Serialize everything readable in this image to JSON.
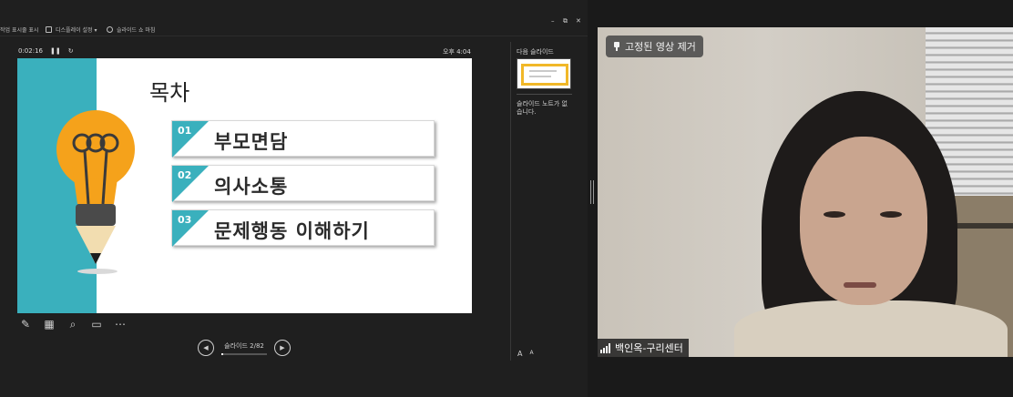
{
  "toolbar": {
    "show_taskbar": "작업 표시줄 표시",
    "display_settings": "디스플레이 설정 ▾",
    "end_slideshow": "슬라이드 쇼 마침"
  },
  "window_controls": {
    "minimize": "–",
    "restore": "⧉",
    "close": "✕"
  },
  "presenter": {
    "elapsed": "0:02:16",
    "pause": "❚❚",
    "reset": "↻",
    "clock": "오후 4:04",
    "next_slide_label": "다음 슬라이드",
    "notes_text": "슬라이드 노트가 없습니다.",
    "font_increase": "A",
    "font_decrease": "A"
  },
  "slide": {
    "title": "목차",
    "items": [
      {
        "num": "01",
        "label": "부모면담"
      },
      {
        "num": "02",
        "label": "의사소통"
      },
      {
        "num": "03",
        "label": "문제행동 이해하기"
      }
    ]
  },
  "navigation": {
    "prev": "◀",
    "next": "▶",
    "counter": "슬라이드 2/82",
    "progress": 0.0244
  },
  "tools": {
    "pen": "✎",
    "grid": "▦",
    "zoom": "⌕",
    "screen": "▭",
    "more": "⋯"
  },
  "video": {
    "pin_label": "고정된 영상 제거",
    "participant_name": "백인옥-구리센터"
  },
  "colors": {
    "accent_teal": "#3ab0bd",
    "bulb_orange": "#f5a21b",
    "panel_bg": "#1f1f1f"
  }
}
